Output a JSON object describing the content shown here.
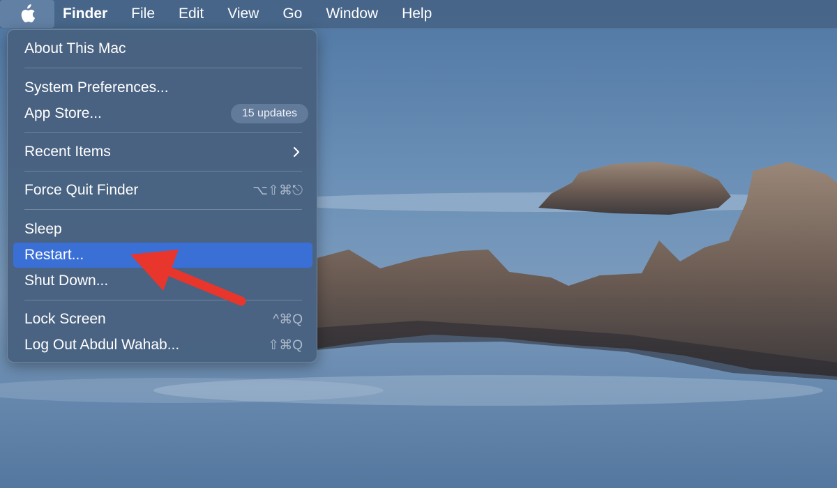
{
  "menubar": {
    "apple_icon": "apple-logo-icon",
    "items": [
      "Finder",
      "File",
      "Edit",
      "View",
      "Go",
      "Window",
      "Help"
    ]
  },
  "apple_menu": {
    "about": "About This Mac",
    "system_preferences": "System Preferences...",
    "app_store": "App Store...",
    "app_store_badge": "15 updates",
    "recent_items": "Recent Items",
    "force_quit": "Force Quit Finder",
    "force_quit_shortcut": "⌥⇧⌘⎋",
    "sleep": "Sleep",
    "restart": "Restart...",
    "shut_down": "Shut Down...",
    "lock_screen": "Lock Screen",
    "lock_screen_shortcut": "^⌘Q",
    "log_out": "Log Out Abdul Wahab...",
    "log_out_shortcut": "⇧⌘Q"
  },
  "colors": {
    "highlight": "#3a6fd6",
    "annotation_arrow": "#e8362c"
  }
}
